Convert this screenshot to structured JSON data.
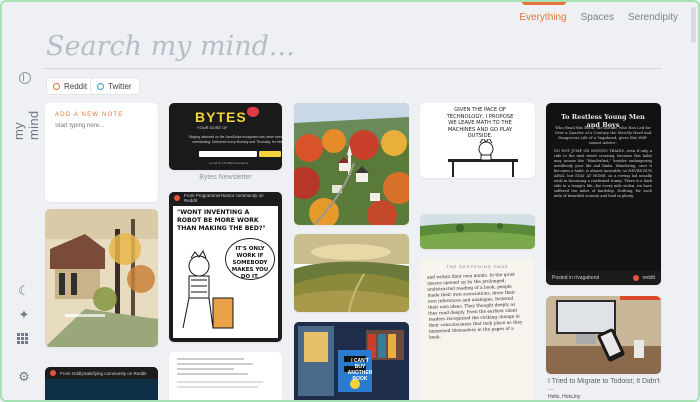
{
  "brand": "my mind",
  "search": {
    "placeholder": "Search my mind..."
  },
  "nav": {
    "tabs": [
      "Everything",
      "Spaces",
      "Serendipity"
    ],
    "active": "Everything"
  },
  "filters": [
    {
      "label": "Reddit"
    },
    {
      "label": "Twitter"
    }
  ],
  "note": {
    "label": "ADD A NEW NOTE",
    "placeholder": "Start typing here..."
  },
  "bytes": {
    "logo": "BYTES",
    "tagline": "YOUR DOSE OF",
    "desc": "Staying informed on the JavaScript ecosystem has never been so entertaining. Delivered every Monday and Thursday, for free.",
    "cta": "GET BYTES",
    "footer": "Loved by 175,000 developers",
    "caption": "Bytes Newsletter"
  },
  "comic1": {
    "source": "From ProgrammerHumor community on Reddit",
    "bubble1": "\"WONT INVENTING A ROBOT BE MORE WORK THAN MAKING THE BED?\"",
    "bubble2": "IT'S ONLY WORK IF SOMEBODY MAKES YOU DO IT."
  },
  "comic2": {
    "text": "GIVEN THE PACE OF TECHNOLOGY, I PROPOSE WE LEAVE MATH TO THE MACHINES AND GO PLAY OUTSIDE."
  },
  "book": {
    "title": "To Restless Young Men and Boys",
    "sub": "Who Read this Book, the Author, who Has Led for Over a Quarter of a Century the Strictly Hard and Dangerous Life of a Vagabond, gives this Well-meant Advice:",
    "body": "DO NOT JUMP ON MOVING TRAINS, even if only a ride to the next street crossing, because this habit may arouse the \"Wanderlust,\" besides endangering needlessly your life and limbs. Wandering, once it becomes a habit, is almost incurable, so NEVER RUN AWAY, but STAY AT HOME, as a roving lad usually ends in becoming a confirmed tramp. There is a dark side to a tramp's life—for every mile stolen, we have suffered ten miles of hardship. Nothing, for each mile of beautiful scenery and food in plenty,",
    "posted": "Posted in r/vagabond",
    "source": "reddit"
  },
  "bookpage": {
    "header": "THE DEEPENING PAGE",
    "text": "and within their own minds. In the quiet spaces opened up by the prolonged, undistracted reading of a book, people made their own associations, drew their own inferences and analogies, fostered their own ideas. They thought deeply as they read deeply. Even the earliest silent readers recognized the striking change in their consciousness that took place as they immersed themselves in the pages of a book."
  },
  "article": {
    "caption": "I Tried to Migrate to Todoist; It Didn't ..."
  },
  "bottom": {
    "comic3_source": "From OddlySatisfying community on Reddit",
    "book_shirt": "I CAN'T BUY ANOTHER BOOK",
    "greeting": "Hello, HotsJoy"
  },
  "colors": {
    "accent": "#e5743a",
    "reddit": "#e5543a",
    "twitter": "#2a9fd6"
  }
}
